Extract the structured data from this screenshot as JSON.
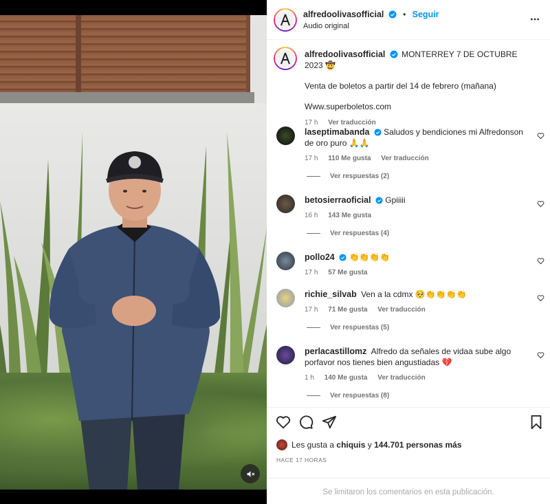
{
  "post": {
    "username": "alfredoolivasofficial",
    "follow_label": "Seguir",
    "audio_label": "Audio original",
    "separator": "•"
  },
  "caption": {
    "username": "alfredoolivasofficial",
    "headline": "MONTERREY 7 DE OCTUBRE 2023",
    "emoji": "🤠",
    "line1": "Venta de boletos a partir del 14 de febrero (mañana)",
    "line2": "Www.superboletos.com",
    "time": "17 h",
    "translate": "Ver traducción"
  },
  "comments": [
    {
      "username": "laseptimabanda",
      "verified": true,
      "text": "Saludos y bendiciones mi Alfredonson de oro puro 🙏🙏",
      "time": "17 h",
      "likes": "110 Me gusta",
      "translate": "Ver traducción",
      "replies": "Ver respuestas (2)"
    },
    {
      "username": "betosierraoficial",
      "verified": true,
      "text": "Gpiiiii",
      "time": "16 h",
      "likes": "143 Me gusta",
      "translate": "",
      "replies": "Ver respuestas (4)"
    },
    {
      "username": "pollo24",
      "verified": true,
      "text": "👏👏👏👏",
      "time": "17 h",
      "likes": "57 Me gusta",
      "translate": "",
      "replies": ""
    },
    {
      "username": "richie_silvab",
      "verified": false,
      "text": "Ven a la cdmx 🥺👏👏👏👏",
      "time": "17 h",
      "likes": "71 Me gusta",
      "translate": "Ver traducción",
      "replies": "Ver respuestas (5)"
    },
    {
      "username": "perlacastillomz",
      "verified": false,
      "text": "Alfredo da señales de vidaa sube algo porfavor nos tienes bien angustiadas 💔",
      "time": "1 h",
      "likes": "140 Me gusta",
      "translate": "Ver traducción",
      "replies": "Ver respuestas (8)"
    }
  ],
  "footer": {
    "likes_prefix": "Les gusta a",
    "likes_user": "chiquis",
    "likes_join": "y",
    "likes_count": "144.701 personas más",
    "timestamp": "HACE 17 HORAS",
    "comments_limited": "Se limitaron los comentarios en esta publicación."
  },
  "colors": {
    "link_blue": "#0095f6",
    "verified_blue": "#0095f6",
    "muted_text": "#737373"
  },
  "icons": [
    "verified-badge-icon",
    "more-options-icon",
    "heart-icon",
    "comment-icon",
    "share-icon",
    "bookmark-icon",
    "mute-icon"
  ]
}
